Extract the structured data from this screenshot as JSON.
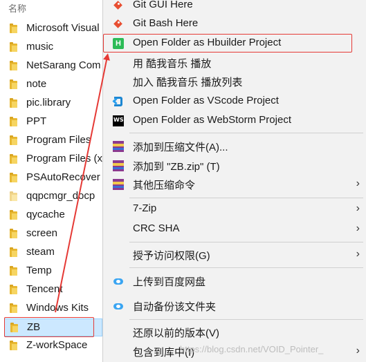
{
  "explorer": {
    "column_header": "名称",
    "folders": [
      {
        "name": "Microsoft Visual",
        "selected": false
      },
      {
        "name": "music",
        "selected": false
      },
      {
        "name": "NetSarang Com",
        "selected": false
      },
      {
        "name": "note",
        "selected": false
      },
      {
        "name": "pic.library",
        "selected": false
      },
      {
        "name": "PPT",
        "selected": false
      },
      {
        "name": "Program Files",
        "selected": false
      },
      {
        "name": "Program Files (x",
        "selected": false
      },
      {
        "name": "PSAutoRecover",
        "selected": false
      },
      {
        "name": "qqpcmgr_docp",
        "selected": false
      },
      {
        "name": "qycache",
        "selected": false
      },
      {
        "name": "screen",
        "selected": false
      },
      {
        "name": "steam",
        "selected": false
      },
      {
        "name": "Temp",
        "selected": false
      },
      {
        "name": "Tencent",
        "selected": false
      },
      {
        "name": "Windows Kits",
        "selected": false
      },
      {
        "name": "ZB",
        "selected": true
      },
      {
        "name": "Z-workSpace",
        "selected": false
      }
    ]
  },
  "context_menu": {
    "items": [
      {
        "label": "Git GUI Here",
        "icon": "git-icon"
      },
      {
        "label": "Git Bash Here",
        "icon": "git-icon"
      },
      {
        "label": "Open Folder as Hbuilder Project",
        "icon": "hbuilder-icon",
        "highlighted": true
      },
      {
        "label": "用 酷我音乐 播放",
        "icon": ""
      },
      {
        "label": "加入 酷我音乐 播放列表",
        "icon": ""
      },
      {
        "label": "Open Folder as VScode Project",
        "icon": "vscode-icon"
      },
      {
        "label": "Open Folder as WebStorm Project",
        "icon": "webstorm-icon"
      },
      {
        "label": "添加到压缩文件(A)...",
        "icon": "winrar-icon"
      },
      {
        "label": "添加到 \"ZB.zip\" (T)",
        "icon": "winrar-icon"
      },
      {
        "label": "其他压缩命令",
        "icon": "winrar-icon",
        "submenu": true
      },
      {
        "label": "7-Zip",
        "icon": "",
        "submenu": true
      },
      {
        "label": "CRC SHA",
        "icon": "",
        "submenu": true
      },
      {
        "label": "授予访问权限(G)",
        "icon": "",
        "submenu": true
      },
      {
        "label": "上传到百度网盘",
        "icon": "baidu-cloud-icon"
      },
      {
        "label": "自动备份该文件夹",
        "icon": "baidu-cloud-icon"
      },
      {
        "label": "还原以前的版本(V)",
        "icon": ""
      },
      {
        "label": "包含到库中(I)",
        "icon": "",
        "submenu": true
      }
    ],
    "submenu_arrow": "›"
  },
  "watermark": "https://blog.csdn.net/VOID_Pointer_",
  "colors": {
    "highlight_border": "#e53935",
    "selection_bg": "#cce8ff",
    "menu_bg": "#f2f2f2"
  }
}
